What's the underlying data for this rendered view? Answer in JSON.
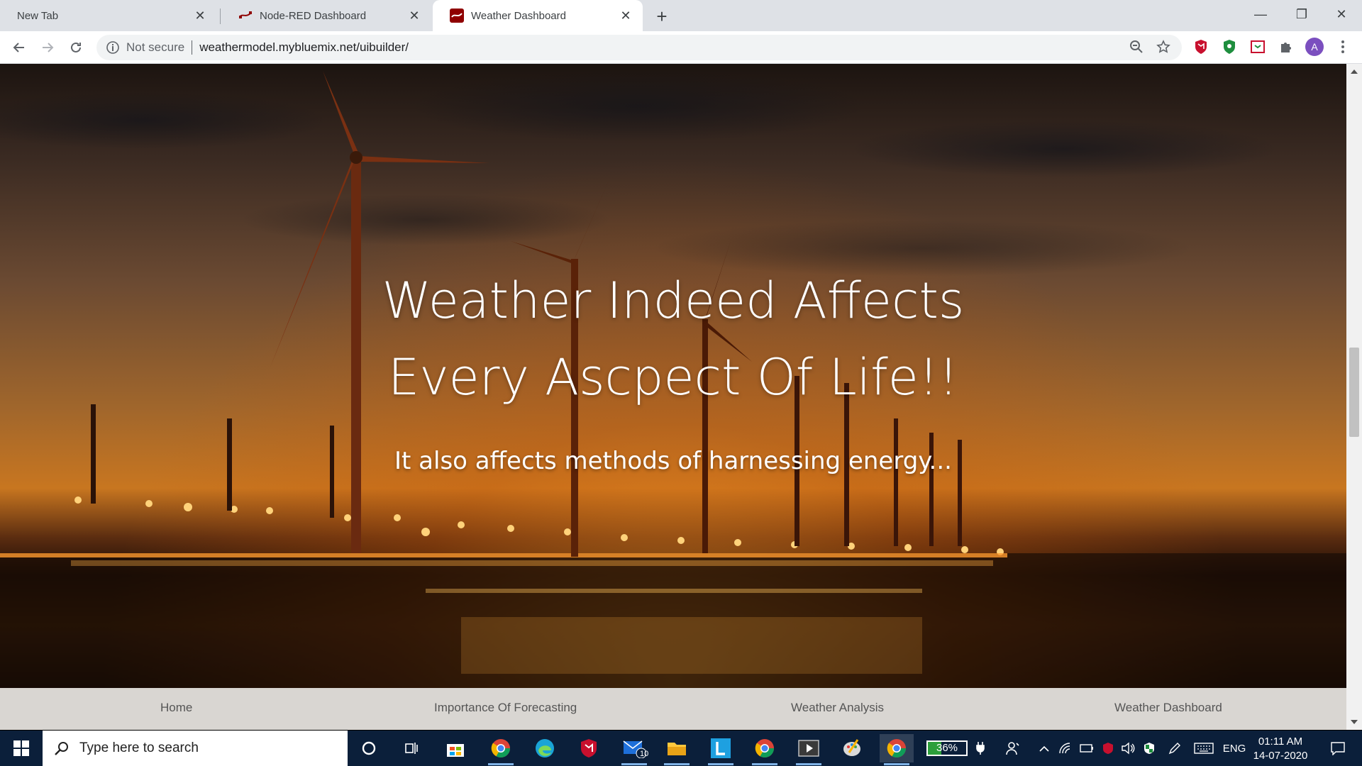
{
  "tabs": [
    {
      "title": "New Tab"
    },
    {
      "title": "Node-RED Dashboard"
    },
    {
      "title": "Weather Dashboard"
    }
  ],
  "tab_close_glyph": "✕",
  "new_tab_glyph": "+",
  "window_controls": {
    "minimize": "—",
    "restore": "❐",
    "close": "✕"
  },
  "address_bar": {
    "security_label": "Not secure",
    "url": "weathermodel.mybluemix.net/uibuilder/"
  },
  "profile_initial": "A",
  "hero": {
    "title_line1": "Weather Indeed Affects",
    "title_line2": "Every Ascpect Of Life!!",
    "subtitle": "It also affects methods of harnessing energy..."
  },
  "bottom_nav": [
    "Home",
    "Importance Of Forecasting",
    "Weather Analysis",
    "Weather Dashboard"
  ],
  "taskbar": {
    "search_placeholder": "Type here to search",
    "mail_badge": "10",
    "battery_label": "36%",
    "battery_level": 0.36,
    "language": "ENG",
    "time": "01:11 AM",
    "date": "14-07-2020",
    "icons": [
      "cortana-icon",
      "task-view-icon",
      "store-icon",
      "chrome-icon",
      "edge-icon",
      "mcafee-icon",
      "mail-icon",
      "file-explorer-icon",
      "l-app-icon",
      "chrome-icon",
      "media-player-icon",
      "paint-icon",
      "chrome-icon"
    ]
  },
  "colors": {
    "accent": "#0b1f3a",
    "tab_bg": "#dee1e6",
    "nav_text": "#555555"
  }
}
